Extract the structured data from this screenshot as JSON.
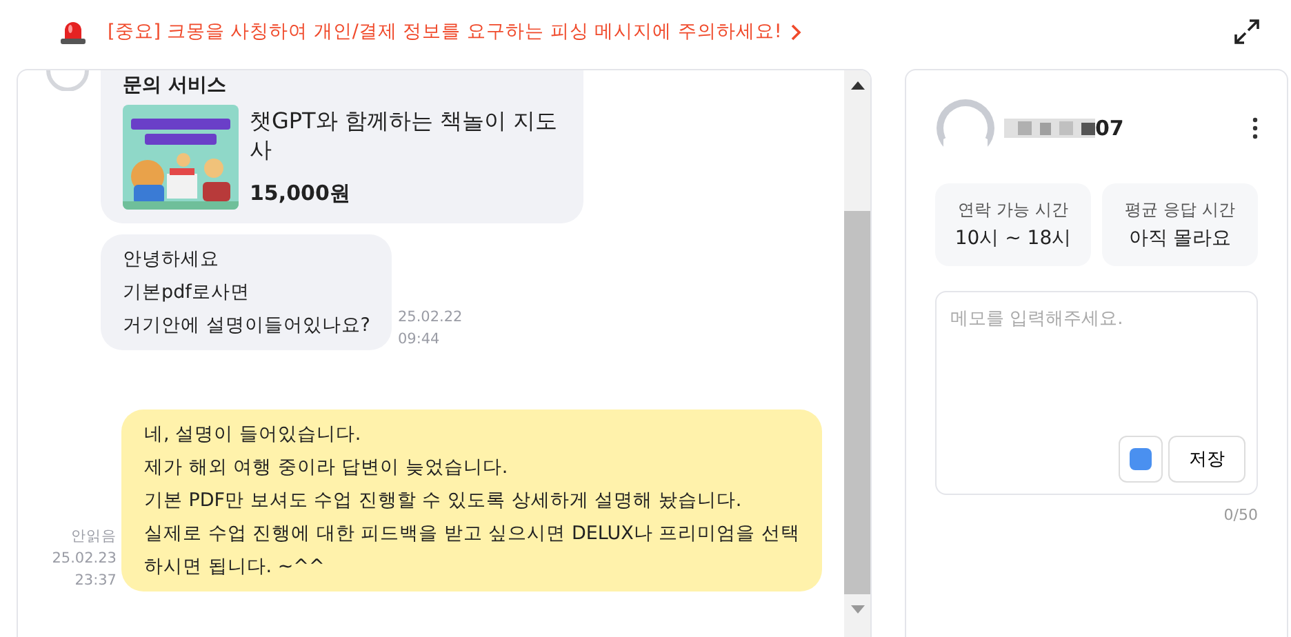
{
  "notice": {
    "text": "[중요] 크몽을 사칭하여 개인/결제 정보를 요구하는 피싱 메시지에 주의하세요!"
  },
  "chat": {
    "messages": [
      {
        "kind": "product",
        "title": "문의 서비스",
        "product_name": "챗GPT와 함께하는 책놀이 지도사",
        "price": "15,000원"
      },
      {
        "kind": "incoming",
        "lines": [
          "안녕하세요",
          "기본pdf로사면",
          "거기안에 설명이들어있나요?"
        ],
        "date": "25.02.22",
        "time": "09:44"
      },
      {
        "kind": "outgoing",
        "lines": [
          "네, 설명이 들어있습니다.",
          "제가 해외 여행 중이라 답변이 늦었습니다.",
          "기본 PDF만 보셔도 수업 진행할 수 있도록 상세하게 설명해 놨습니다.",
          "실제로 수업 진행에 대한 피드백을 받고 싶으시면 DELUX나 프리미엄을 선택",
          "하시면 됩니다. ~^^"
        ],
        "status": "안읽음",
        "date": "25.02.23",
        "time": "23:37"
      }
    ]
  },
  "profile": {
    "name_visible": "07",
    "stats": [
      {
        "label": "연락 가능 시간",
        "value": "10시 ~ 18시"
      },
      {
        "label": "평균 응답 시간",
        "value": "아직 몰라요"
      }
    ],
    "memo": {
      "placeholder": "메모를 입력해주세요.",
      "color": "#4a90f0",
      "save": "저장",
      "counter": "0/50"
    }
  }
}
